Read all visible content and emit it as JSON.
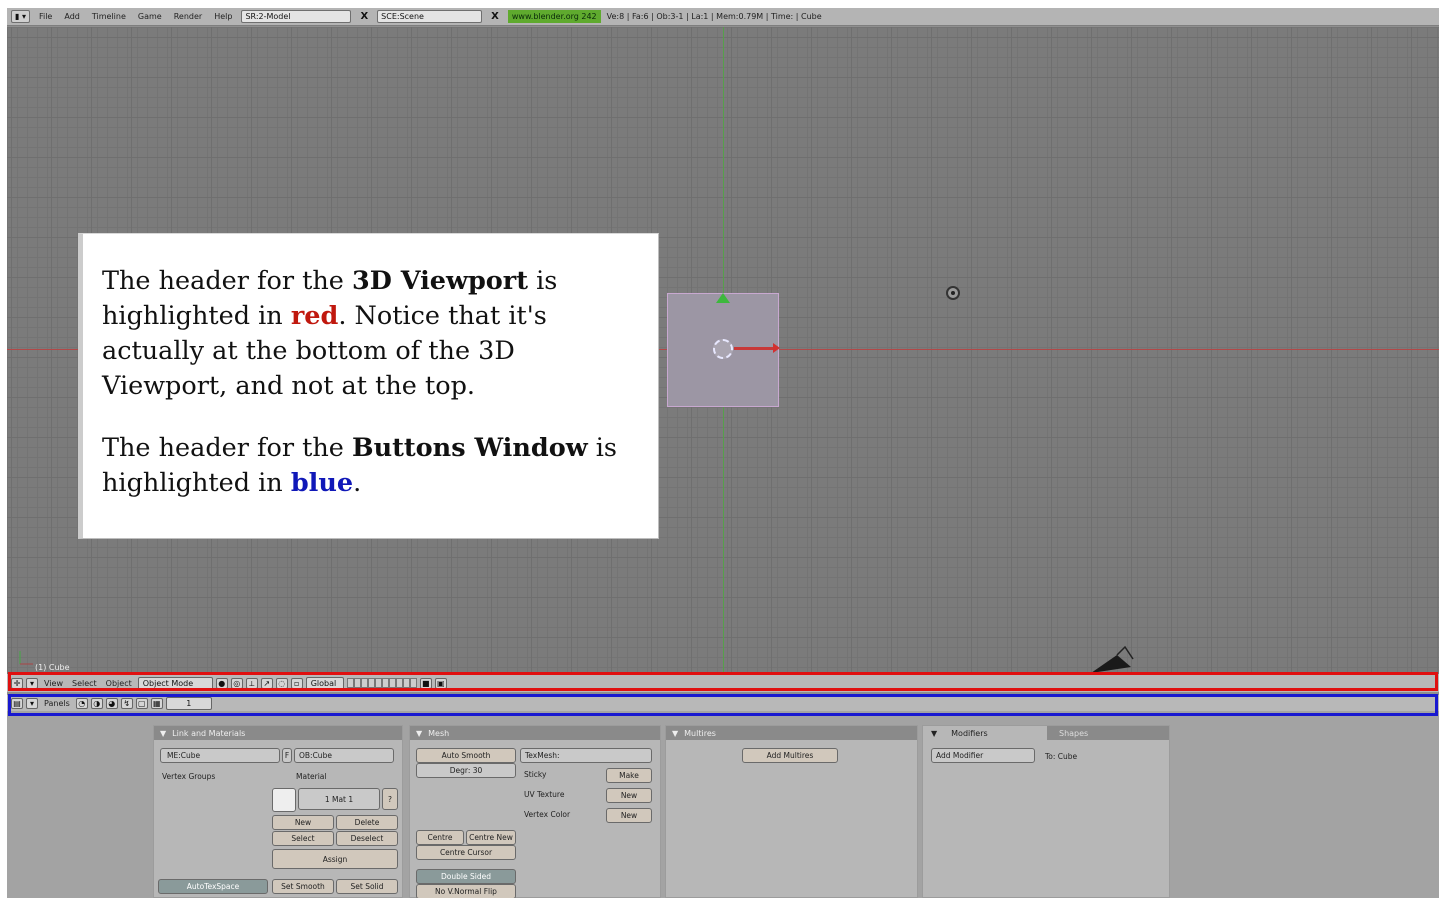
{
  "topbar": {
    "menus": [
      "File",
      "Add",
      "Timeline",
      "Game",
      "Render",
      "Help"
    ],
    "screen_field": "SR:2-Model",
    "scene_field": "SCE:Scene",
    "url": "www.blender.org 242",
    "stats": "Ve:8 | Fa:6 | Ob:3-1 | La:1  | Mem:0.79M  | Time: | Cube",
    "close_glyph": "X"
  },
  "viewport": {
    "object_label": "(1) Cube"
  },
  "callout": {
    "p1_a": "The header for the ",
    "p1_b": "3D Viewport",
    "p1_c": " is highlighted in ",
    "p1_red": "red",
    "p1_d": ". Notice that it's actually at the bottom of the 3D Viewport, and not at the top.",
    "p2_a": "The header for the ",
    "p2_b": "Buttons Window",
    "p2_c": " is highlighted in ",
    "p2_blue": "blue",
    "p2_d": "."
  },
  "header3d": {
    "menus": [
      "View",
      "Select",
      "Object"
    ],
    "mode": "Object Mode",
    "orientation": "Global"
  },
  "headerbtn": {
    "menu": "Panels",
    "frame": "1"
  },
  "panels": {
    "link": {
      "title": "Link and Materials",
      "me_field": "ME:Cube",
      "ob_field": "OB:Cube",
      "f_btn": "F",
      "vgroups": "Vertex Groups",
      "material": "Material",
      "mat_field": "1 Mat 1",
      "mat_q": "?",
      "new": "New",
      "delete": "Delete",
      "select": "Select",
      "deselect": "Deselect",
      "assign": "Assign",
      "autotex": "AutoTexSpace",
      "setsmooth": "Set Smooth",
      "setsolid": "Set Solid"
    },
    "mesh": {
      "title": "Mesh",
      "autosmooth": "Auto Smooth",
      "degr": "Degr: 30",
      "texmesh": "TexMesh:",
      "sticky": "Sticky",
      "make": "Make",
      "uvtex": "UV Texture",
      "new1": "New",
      "vcol": "Vertex Color",
      "new2": "New",
      "centre": "Centre",
      "centrenew": "Centre New",
      "centrecursor": "Centre Cursor",
      "doublesided": "Double Sided",
      "novnormal": "No V.Normal Flip"
    },
    "multires": {
      "title": "Multires",
      "add": "Add Multires"
    },
    "modifiers": {
      "tab1": "Modifiers",
      "tab2": "Shapes",
      "add": "Add Modifier",
      "to": "To: Cube"
    }
  },
  "colors": {
    "red_frame": "#e01010",
    "blue_frame": "#1818d0",
    "url_bg": "#5faa2e"
  }
}
